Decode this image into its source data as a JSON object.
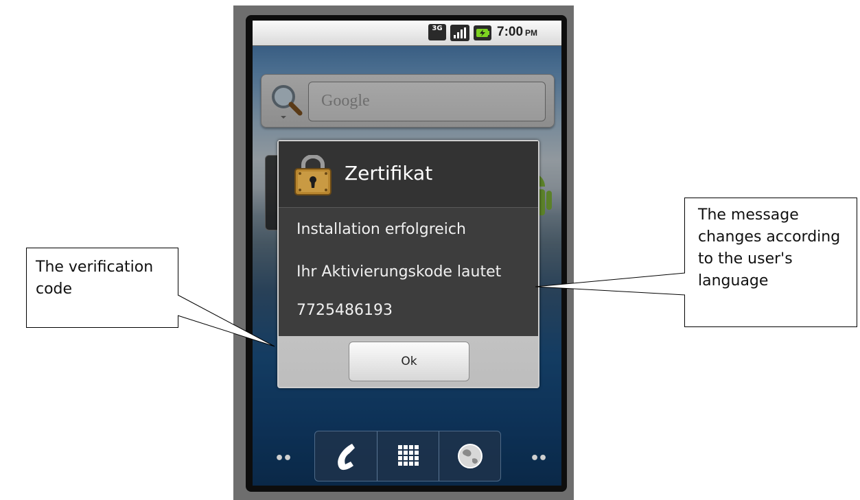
{
  "status_bar": {
    "network_label": "3G",
    "time": "7:00",
    "ampm": "PM"
  },
  "search_widget": {
    "placeholder": "Google"
  },
  "dialog": {
    "title": "Zertifikat",
    "line_1": "Installation erfolgreich",
    "line_2": "Ihr Aktivierungskode lautet",
    "code": "7725486193",
    "ok_label": "Ok"
  },
  "dock": {
    "items": [
      "phone-icon",
      "apps-grid-icon",
      "browser-globe-icon"
    ]
  },
  "callouts": {
    "left": "The verification code",
    "right": "The message changes according to the user's language"
  },
  "colors": {
    "dialog_bg": "#3d3d3d",
    "dialog_footer": "#c2c2c2",
    "status_bar": "#e8e8e8"
  }
}
